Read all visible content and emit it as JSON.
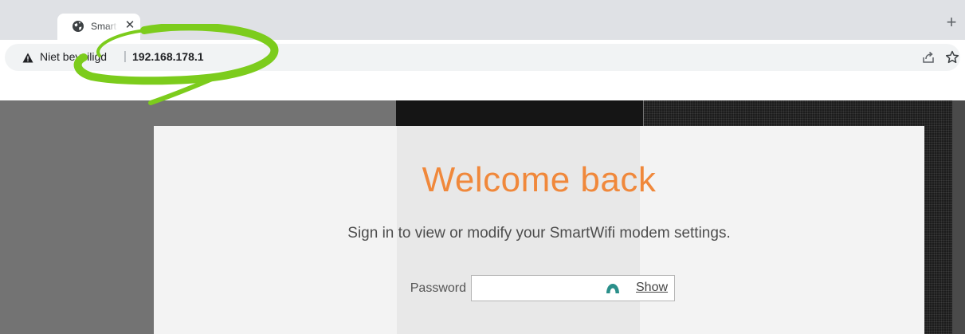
{
  "browser": {
    "tab": {
      "title": "Smart",
      "favicon": "globe-icon",
      "close_glyph": "✕"
    },
    "new_tab_glyph": "+",
    "address_bar": {
      "security_label": "Niet beveiligd",
      "security_icon": "warning-triangle-icon",
      "separator": "|",
      "url": "192.168.178.1"
    },
    "toolbar_icons": [
      "share-icon",
      "bookmark-star-icon"
    ],
    "annotation_color": "#7ccc1c"
  },
  "page": {
    "heading": "Welcome back",
    "subtitle": "Sign in to view or modify your SmartWifi modem settings.",
    "password": {
      "label": "Password",
      "value": "",
      "placeholder": "",
      "extension_icon": "password-manager-icon",
      "show_label": "Show"
    },
    "colors": {
      "accent": "#f0883b",
      "card_background": "#f3f3f3"
    }
  }
}
